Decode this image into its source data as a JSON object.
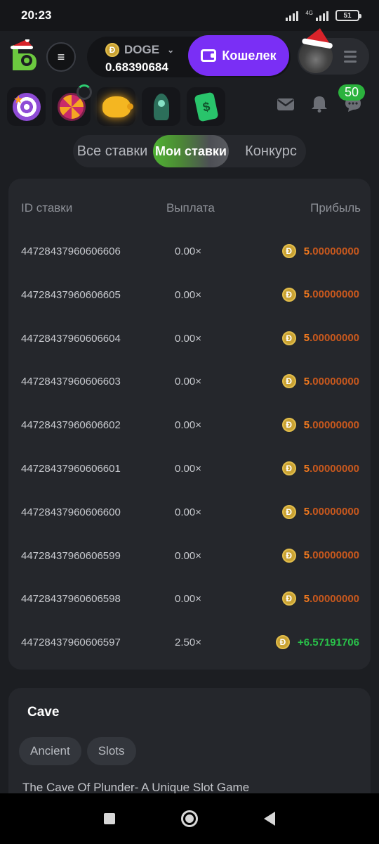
{
  "status_bar": {
    "time": "20:23",
    "network": "4G",
    "battery": "51"
  },
  "header": {
    "currency": "DOGE",
    "balance": "0.68390684",
    "wallet_label": "Кошелек",
    "coin_symbol": "Ð"
  },
  "notifications": {
    "chat_count": "50"
  },
  "tabs": [
    {
      "label": "Все ставки",
      "active": false
    },
    {
      "label": "Мои ставки",
      "active": true
    },
    {
      "label": "Конкурс",
      "active": false
    }
  ],
  "bets_table": {
    "headers": {
      "id": "ID ставки",
      "payout": "Выплата",
      "profit": "Прибыль"
    },
    "rows": [
      {
        "id": "44728437960606606",
        "payout": "0.00×",
        "profit_int": "5",
        "profit_frac": ".00000000",
        "win": false
      },
      {
        "id": "44728437960606605",
        "payout": "0.00×",
        "profit_int": "5",
        "profit_frac": ".00000000",
        "win": false
      },
      {
        "id": "44728437960606604",
        "payout": "0.00×",
        "profit_int": "5",
        "profit_frac": ".00000000",
        "win": false
      },
      {
        "id": "44728437960606603",
        "payout": "0.00×",
        "profit_int": "5",
        "profit_frac": ".00000000",
        "win": false
      },
      {
        "id": "44728437960606602",
        "payout": "0.00×",
        "profit_int": "5",
        "profit_frac": ".00000000",
        "win": false
      },
      {
        "id": "44728437960606601",
        "payout": "0.00×",
        "profit_int": "5",
        "profit_frac": ".00000000",
        "win": false
      },
      {
        "id": "44728437960606600",
        "payout": "0.00×",
        "profit_int": "5",
        "profit_frac": ".00000000",
        "win": false
      },
      {
        "id": "44728437960606599",
        "payout": "0.00×",
        "profit_int": "5",
        "profit_frac": ".00000000",
        "win": false
      },
      {
        "id": "44728437960606598",
        "payout": "0.00×",
        "profit_int": "5",
        "profit_frac": ".00000000",
        "win": false
      },
      {
        "id": "44728437960606597",
        "payout": "2.50×",
        "profit_int": "+6.57191706",
        "profit_frac": "",
        "win": true
      }
    ]
  },
  "game_info": {
    "title": "Cave",
    "tags": [
      "Ancient",
      "Slots"
    ],
    "description": "The Cave Of Plunder- A Unique Slot Game"
  },
  "colors": {
    "accent": "#7a2ff5",
    "loss": "#f47a1e",
    "win": "#29c24a",
    "coin": "#c9a233"
  }
}
